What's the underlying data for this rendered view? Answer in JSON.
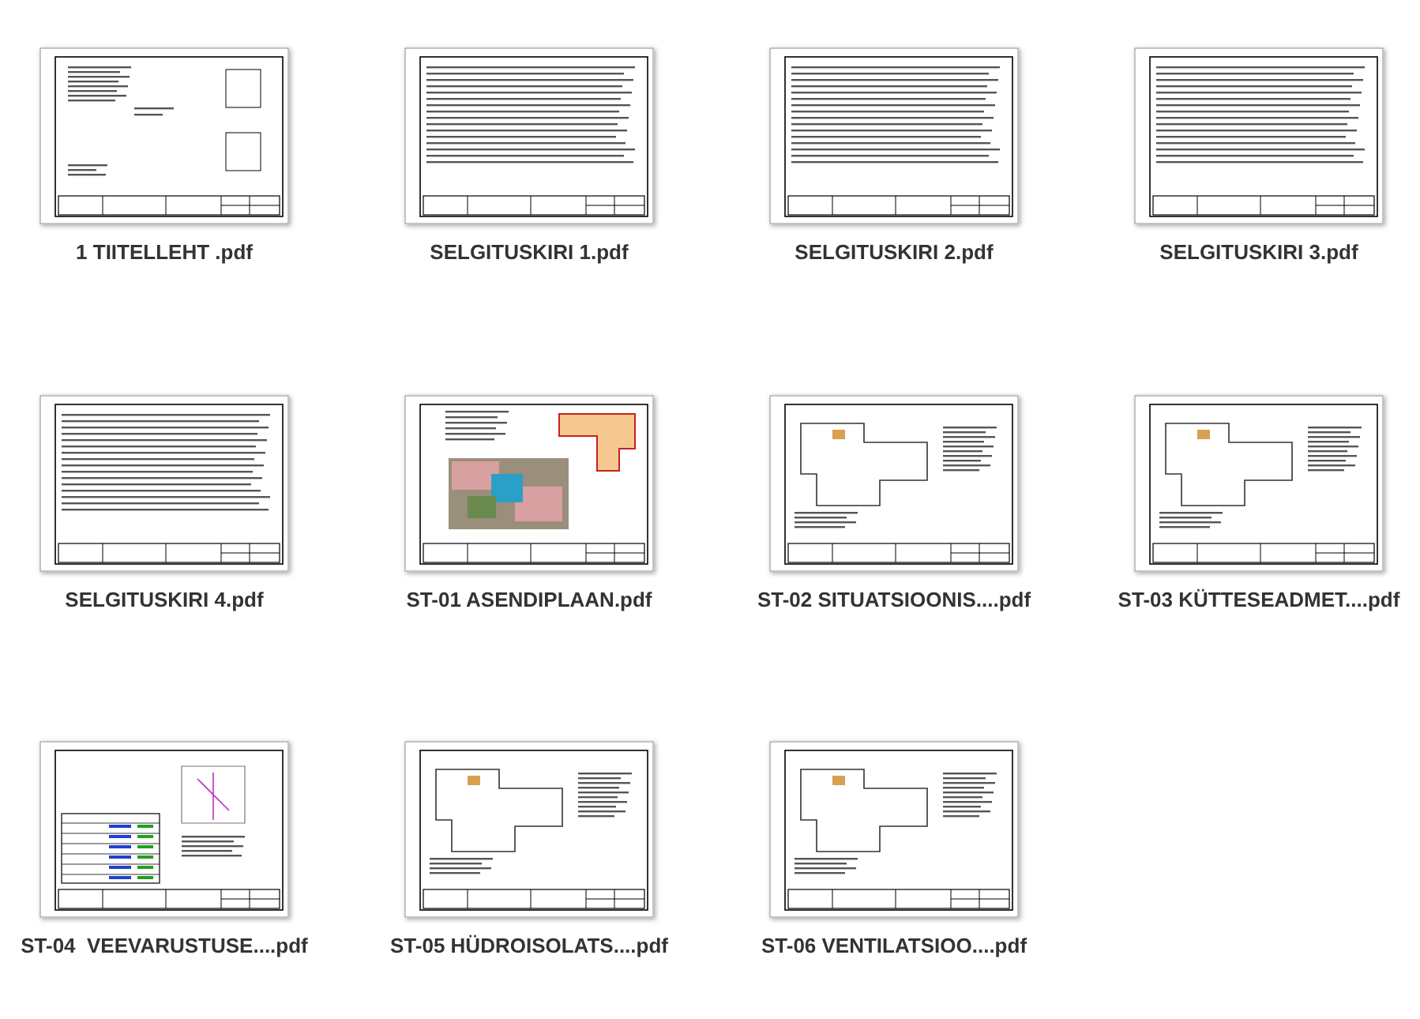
{
  "files": [
    {
      "name": "1 TIITELLEHT .pdf",
      "kind": "title"
    },
    {
      "name": "SELGITUSKIRI 1.pdf",
      "kind": "text"
    },
    {
      "name": "SELGITUSKIRI 2.pdf",
      "kind": "text"
    },
    {
      "name": "SELGITUSKIRI 3.pdf",
      "kind": "text"
    },
    {
      "name": "SELGITUSKIRI 4.pdf",
      "kind": "text"
    },
    {
      "name": "ST-01 ASENDIPLAAN.pdf",
      "kind": "site"
    },
    {
      "name": "ST-02 SITUATSIOONIS....pdf",
      "kind": "plan"
    },
    {
      "name": "ST-03 KÜTTESEADMET....pdf",
      "kind": "plan"
    },
    {
      "name": "ST-04  VEEVARUSTUSE....pdf",
      "kind": "table"
    },
    {
      "name": "ST-05 HÜDROISOLATS....pdf",
      "kind": "plan"
    },
    {
      "name": "ST-06 VENTILATSIOO....pdf",
      "kind": "plan"
    }
  ]
}
